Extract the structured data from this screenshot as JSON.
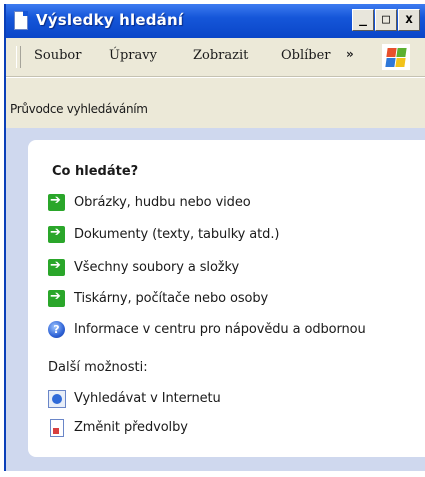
{
  "window": {
    "title": "Výsledky hledání"
  },
  "titlebar": {
    "minimize": "_",
    "maximize": "□",
    "close": "x"
  },
  "menubar": {
    "items": [
      "Soubor",
      "Úpravy",
      "Zobrazit",
      "Oblíber"
    ],
    "overflow": "»"
  },
  "addressbar": {
    "label": "Průvodce vyhledáváním"
  },
  "panel": {
    "heading": "Co hledáte?",
    "options": [
      {
        "label": "Obrázky, hudbu nebo video",
        "icon": "green-arrow-icon"
      },
      {
        "label": "Dokumenty (texty, tabulky atd.)",
        "icon": "green-arrow-icon"
      },
      {
        "label": "Všechny soubory a složky",
        "icon": "green-arrow-icon"
      },
      {
        "label": "Tiskárny, počítače nebo osoby",
        "icon": "green-arrow-icon"
      },
      {
        "label": "Informace v centru pro nápovědu a odbornou",
        "icon": "help-icon"
      }
    ],
    "more_heading": "Další možnosti:",
    "more_options": [
      {
        "label": "Vyhledávat v Internetu",
        "icon": "globe-icon"
      },
      {
        "label": "Změnit předvolby",
        "icon": "document-icon"
      }
    ]
  },
  "colors": {
    "titlebar": "#0a46c8",
    "chrome": "#ece9d8",
    "panel": "#cfd8ee",
    "arrow": "#2aa62a"
  }
}
